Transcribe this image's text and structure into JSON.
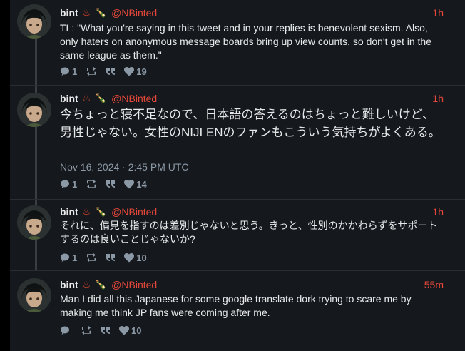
{
  "posts": [
    {
      "name": "bint",
      "emoji": [
        "♨",
        "🍾"
      ],
      "handle": "@NBinted",
      "time": "1h",
      "text": "TL: \"What you're saying in this tweet and in your replies is benevolent sexism. Also, only haters on anonymous message boards bring up view counts, so don't get in the same league as them.\"",
      "replies": "1",
      "likes": "19"
    },
    {
      "name": "bint",
      "emoji": [
        "♨",
        "🍾"
      ],
      "handle": "@NBinted",
      "time": "1h",
      "text": "今ちょっと寝不足なので、日本語の答えるのはちょっと難しいけど、男性じゃない。女性のNIJI ENのファンもこういう気持ちがよくある。",
      "date": "Nov 16, 2024 · 2:45 PM UTC",
      "replies": "1",
      "likes": "14"
    },
    {
      "name": "bint",
      "emoji": [
        "♨",
        "🍾"
      ],
      "handle": "@NBinted",
      "time": "1h",
      "text": "それに、偏見を指すのは差別じゃないと思う。きっと、性別のかかわらずをサポートするのは良いことじゃないか?",
      "replies": "1",
      "likes": "10"
    },
    {
      "name": "bint",
      "emoji": [
        "♨",
        "🍾"
      ],
      "handle": "@NBinted",
      "time": "55m",
      "text": "Man I did all this Japanese for some google translate dork trying to scare me by making me think JP fans were coming after me.",
      "replies": "",
      "likes": "10"
    }
  ],
  "colors": {
    "background": "#000000",
    "panel": "#15181c",
    "accent": "#e5483a",
    "text": "#e7e9ea",
    "muted": "#8b98a5"
  },
  "icons": {
    "reply": "comment-bubble-icon",
    "retweet": "retweet-icon",
    "quote": "quote-icon",
    "like": "heart-icon"
  }
}
